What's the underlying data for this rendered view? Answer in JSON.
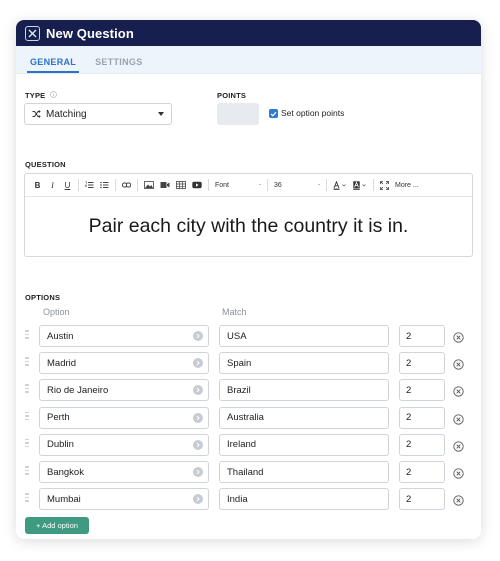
{
  "window": {
    "title": "New Question"
  },
  "tabs": [
    {
      "label": "GENERAL",
      "active": true
    },
    {
      "label": "SETTINGS",
      "active": false
    }
  ],
  "type": {
    "label": "TYPE",
    "value": "Matching"
  },
  "points": {
    "label": "POINTS",
    "value": "",
    "set_option_points_label": "Set option points",
    "set_option_points_checked": true
  },
  "question": {
    "label": "QUESTION",
    "toolbar": {
      "font_label": "Font",
      "size_value": "36",
      "more_label": "More ..."
    },
    "text": "Pair each city with the country it is in."
  },
  "options": {
    "label": "OPTIONS",
    "option_header": "Option",
    "match_header": "Match",
    "rows": [
      {
        "option": "Austin",
        "match": "USA",
        "points": "2"
      },
      {
        "option": "Madrid",
        "match": "Spain",
        "points": "2"
      },
      {
        "option": "Rio de Janeiro",
        "match": "Brazil",
        "points": "2"
      },
      {
        "option": "Perth",
        "match": "Australia",
        "points": "2"
      },
      {
        "option": "Dublin",
        "match": "Ireland",
        "points": "2"
      },
      {
        "option": "Bangkok",
        "match": "Thailand",
        "points": "2"
      },
      {
        "option": "Mumbai",
        "match": "India",
        "points": "2"
      }
    ],
    "add_label": "+ Add option"
  },
  "colors": {
    "header_bg": "#171f4e",
    "accent": "#2a74c4",
    "add_button": "#3f9a82"
  }
}
